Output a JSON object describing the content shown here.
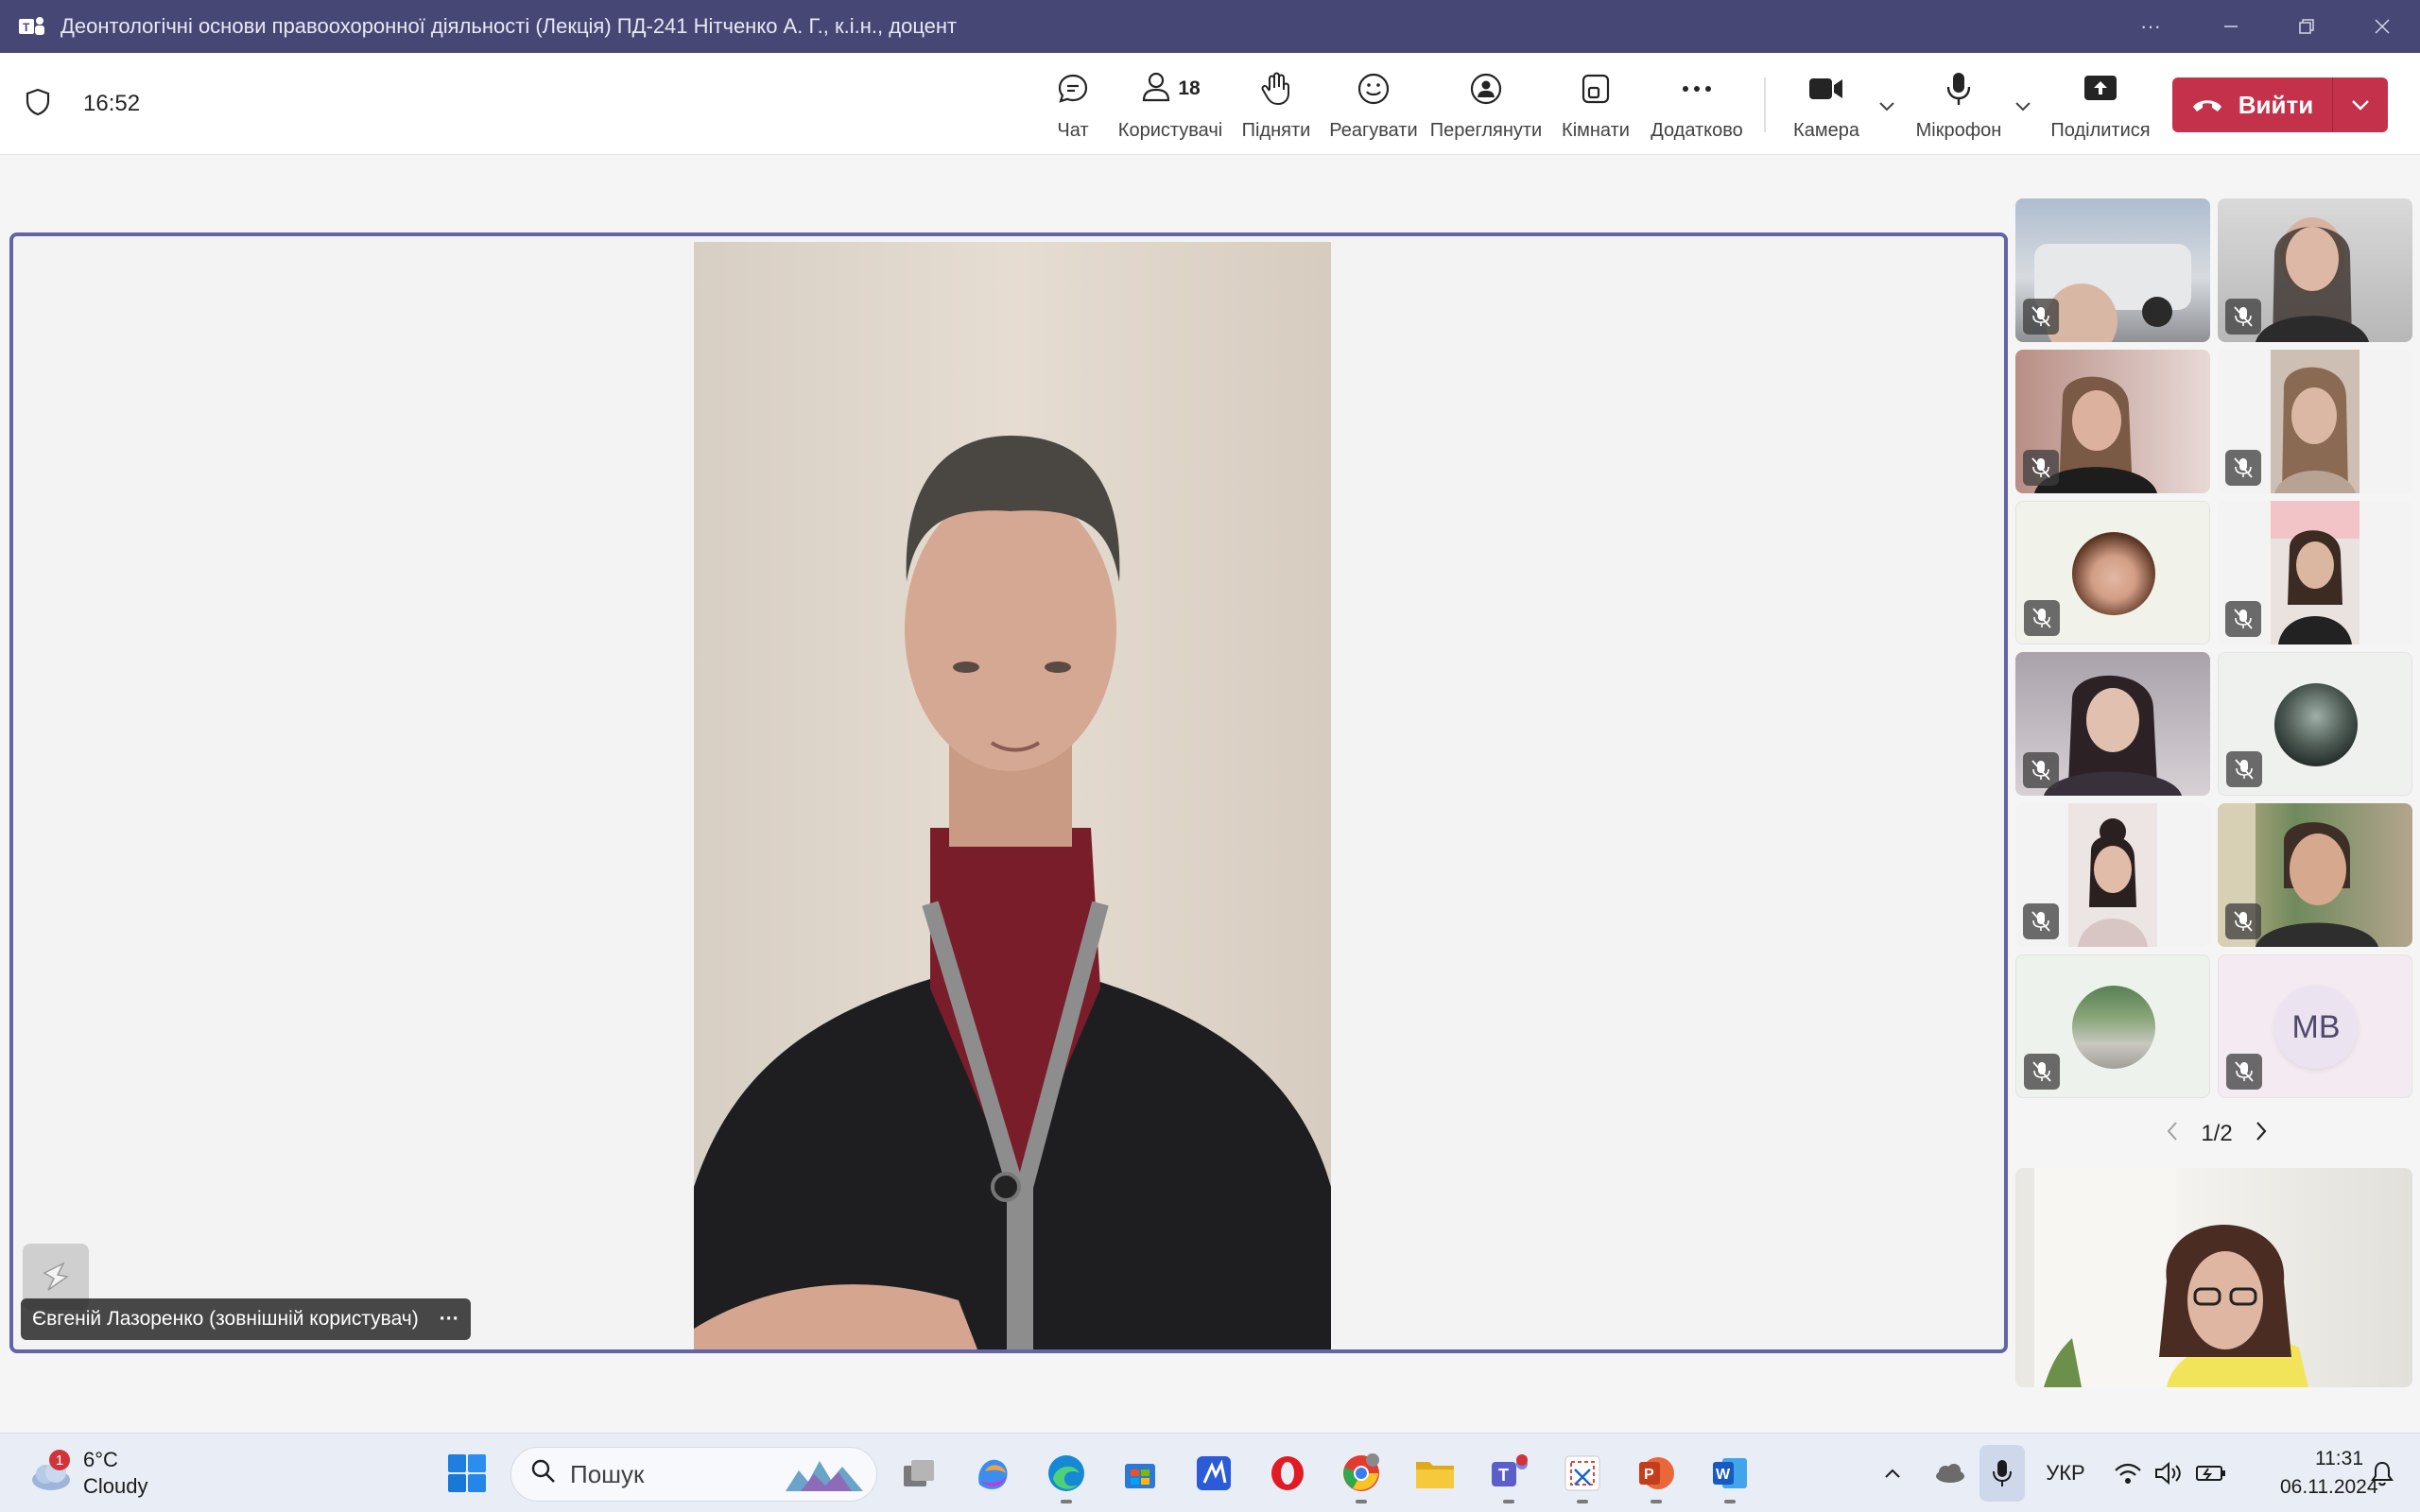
{
  "window": {
    "title": "Деонтологічні основи правоохоронної діяльності (Лекція) ПД-241 Нітченко А. Г., к.і.н., доцент"
  },
  "toolbar": {
    "timer": "16:52",
    "chat": "Чат",
    "people_count": "18",
    "people": "Користувачі",
    "raise": "Підняти",
    "react": "Реагувати",
    "view": "Переглянути",
    "rooms": "Кімнати",
    "more": "Додатково",
    "camera": "Камера",
    "mic": "Мікрофон",
    "share": "Поділитися",
    "leave": "Вийти"
  },
  "stage": {
    "speaker_name": "Євгеній Лазоренко (зовнішній користувач)",
    "speaker_more": "···"
  },
  "gallery": {
    "initials": "МВ",
    "page": "1/2"
  },
  "taskbar": {
    "weather_badge": "1",
    "temperature": "6°C",
    "condition": "Cloudy",
    "search_placeholder": "Пошук",
    "language": "УКР",
    "time": "11:31",
    "date": "06.11.2024"
  },
  "colors": {
    "titlebar": "#464775",
    "accent": "#6264a7",
    "leave": "#c4314b",
    "taskbar": "#e9eef6"
  }
}
